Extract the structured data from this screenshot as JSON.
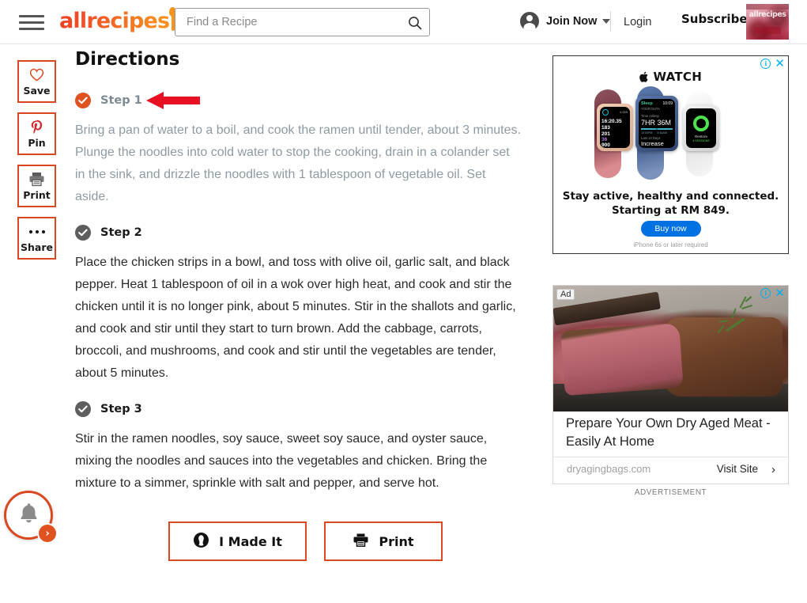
{
  "header": {
    "menu_icon": "hamburger-menu-icon",
    "logo_text": "allrecipes",
    "search": {
      "placeholder": "Find a Recipe",
      "value": "",
      "icon": "search-icon"
    },
    "account_label": "Join Now",
    "account_icon": "user-avatar-icon",
    "login_label": "Login",
    "subscribe_label": "Subscribe",
    "magazine_thumb_text": "allrecipes"
  },
  "rail": {
    "items": [
      {
        "label": "Save",
        "icon": "heart-icon"
      },
      {
        "label": "Pin",
        "icon": "pinterest-icon"
      },
      {
        "label": "Print",
        "icon": "printer-icon"
      },
      {
        "label": "Share",
        "icon": "ellipsis-icon"
      }
    ],
    "notification": {
      "icon": "bell-icon",
      "badge": "›"
    }
  },
  "main": {
    "title": "Directions",
    "steps": [
      {
        "label": "Step 1",
        "state": "done",
        "text": "Bring a pan of water to a boil, and cook the ramen until tender, about 3 minutes. Plunge the noodles into cold water to stop the cooking, drain in a colander set in the sink, and drizzle the noodles with 1 tablespoon of vegetable oil. Set aside.",
        "annotation": "red-left-arrow"
      },
      {
        "label": "Step 2",
        "state": "pending",
        "text": "Place the chicken strips in a bowl, and toss with olive oil, garlic salt, and black pepper. Heat 1 tablespoon of oil in a wok over high heat, and cook and stir the chicken until it is no longer pink, about 5 minutes. Stir in the shallots and garlic, and cook and stir until they start to turn brown. Add the cabbage, carrots, broccoli, and mushrooms, and cook and stir until the vegetables are tender, about 5 minutes."
      },
      {
        "label": "Step 3",
        "state": "pending",
        "text": "Stir in the ramen noodles, soy sauce, sweet soy sauce, and oyster sauce, mixing the noodles and sauces into the vegetables and chicken. Bring the mixture to a simmer, sprinkle with salt and pepper, and serve hot."
      }
    ],
    "actions": [
      {
        "label": "I Made It",
        "icon": "camera-lens-icon"
      },
      {
        "label": "Print",
        "icon": "printer-icon"
      }
    ]
  },
  "ads": {
    "top": {
      "brand": "WATCH",
      "apple_glyph": "",
      "headline_line1": "Stay active, healthy and connected.",
      "headline_line2": "Starting at RM 849.",
      "cta_label": "Buy now",
      "footnote": "iPhone 6s or later required",
      "info_icon": "ad-info-icon",
      "close_icon": "ad-close-icon",
      "watch_faces": [
        {
          "metrics": [
            "16:20.35",
            "183",
            "201",
            "36",
            "900"
          ],
          "unit_labels": [
            "MIN/MI",
            "BPM",
            "FT",
            "LENGTHS",
            "M"
          ]
        },
        {
          "title": "Sleep",
          "subtitle": "YOUR DATA",
          "section": "Time Asleep",
          "value": "7HR 36M",
          "section2": "Last 14 Days",
          "trend": "Increase",
          "time": "10:09"
        },
        {
          "label": "Restore",
          "sublabel": "4 SESSIONS"
        }
      ]
    },
    "bottom": {
      "badge": "Ad",
      "title": "Prepare Your Own Dry Aged Meat - Easily At Home",
      "domain": "dryagingbags.com",
      "cta_label": "Visit Site",
      "chevron": "›",
      "info_icon": "ad-info-icon",
      "close_icon": "ad-close-icon"
    },
    "footnote": "ADVERTISEMENT"
  },
  "colors": {
    "brand_orange": "#d9481f",
    "accent_orange": "#e0521f",
    "arrow_red": "#e81123",
    "muted_text": "#8e9aa1",
    "ad_blue": "#00aeef"
  }
}
